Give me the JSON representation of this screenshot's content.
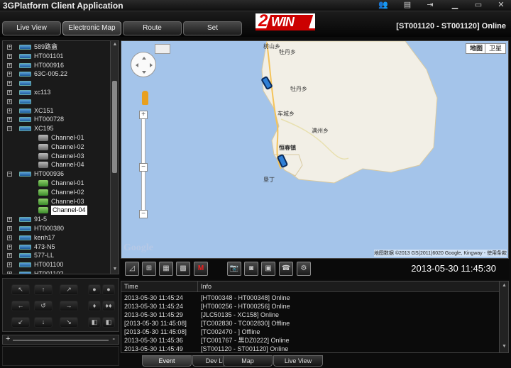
{
  "window": {
    "title": "3GPlatform Client Application"
  },
  "nav": {
    "buttons": [
      {
        "label": "Live View"
      },
      {
        "label": "Electronic Map"
      },
      {
        "label": "Route"
      },
      {
        "label": "Set"
      }
    ],
    "active_index": 1
  },
  "brand": {
    "logo_text_1": "2",
    "logo_text_2": "WIN"
  },
  "device_status": "[ST001120 - ST001120] Online",
  "tree": {
    "items": [
      {
        "type": "device",
        "label": "589路盦",
        "expanded": false
      },
      {
        "type": "device",
        "label": "HT001101",
        "expanded": false
      },
      {
        "type": "device",
        "label": "HT000916",
        "expanded": false
      },
      {
        "type": "device",
        "label": "63C-005.22",
        "expanded": false
      },
      {
        "type": "device",
        "label": "",
        "expanded": false
      },
      {
        "type": "device",
        "label": "xc113",
        "expanded": false
      },
      {
        "type": "device",
        "label": "",
        "expanded": false
      },
      {
        "type": "device",
        "label": "XC151",
        "expanded": false
      },
      {
        "type": "device",
        "label": "HT000728",
        "expanded": false
      },
      {
        "type": "device",
        "label": "XC195",
        "expanded": true
      },
      {
        "type": "channel",
        "label": "Channel-01",
        "online": false
      },
      {
        "type": "channel",
        "label": "Channel-02",
        "online": false
      },
      {
        "type": "channel",
        "label": "Channel-03",
        "online": false
      },
      {
        "type": "channel",
        "label": "Channel-04",
        "online": false
      },
      {
        "type": "device",
        "label": "HT000936",
        "expanded": true
      },
      {
        "type": "channel",
        "label": "Channel-01",
        "online": true
      },
      {
        "type": "channel",
        "label": "Channel-02",
        "online": true
      },
      {
        "type": "channel",
        "label": "Channel-03",
        "online": true
      },
      {
        "type": "channel",
        "label": "Channel-04",
        "online": true,
        "selected": true
      },
      {
        "type": "device",
        "label": "91-5",
        "expanded": false
      },
      {
        "type": "device",
        "label": "HT000380",
        "expanded": false
      },
      {
        "type": "device",
        "label": "kenh17",
        "expanded": false
      },
      {
        "type": "device",
        "label": "473-N5",
        "expanded": false
      },
      {
        "type": "device",
        "label": "577-LL",
        "expanded": false
      },
      {
        "type": "device",
        "label": "HT001100",
        "expanded": false
      },
      {
        "type": "device",
        "label": "HT001102",
        "expanded": false
      }
    ]
  },
  "ptz": {
    "buttons": [
      "↖",
      "↑",
      "↗",
      "●",
      "●",
      "←",
      "↺",
      "→",
      "♦",
      "♦♦",
      "↙",
      "↓",
      "↘",
      "◧",
      "◧"
    ]
  },
  "zoom": {
    "minus": "+",
    "plus": "-"
  },
  "map": {
    "type_buttons": [
      "地图",
      "卫星"
    ],
    "labels": [
      {
        "text": "枋山乡"
      },
      {
        "text": "牡丹乡"
      },
      {
        "text": "牡丹乡"
      },
      {
        "text": "车城乡"
      },
      {
        "text": "满州乡"
      },
      {
        "text": "恒春镇"
      },
      {
        "text": "垦丁"
      }
    ],
    "zoom_in": "+",
    "zoom_out": "−",
    "zoom_min": "−",
    "google_logo": "Google",
    "copyright": "地图数据 ©2013 GS(2011)6020 Google, Kingway - 使用条款"
  },
  "toolbar": {
    "buttons": [
      "layout-1",
      "layout-4",
      "layout-9",
      "layout-16",
      "layout-M",
      "snapshot",
      "capture",
      "record",
      "talk",
      "settings"
    ],
    "m_label": "M",
    "datetime": "2013-05-30  11:45:30"
  },
  "log": {
    "columns": [
      "Time",
      "Info"
    ],
    "rows": [
      {
        "time": "2013-05-30 11:45:24",
        "info": "[HT000348 - HT000348] Online"
      },
      {
        "time": "2013-05-30 11:45:24",
        "info": "[HT000256 - HT000256] Online"
      },
      {
        "time": "2013-05-30 11:45:29",
        "info": "[JLC50135 - XC158] Online"
      },
      {
        "time": "[2013-05-30 11:45:08]",
        "info": "[TC002830 - TC002830] Offline"
      },
      {
        "time": "[2013-05-30 11:45:08]",
        "info": "[TC002470 - ] Offline"
      },
      {
        "time": "2013-05-30 11:45:36",
        "info": "[TC001767 - 黒DZ0222] Online"
      },
      {
        "time": "2013-05-30 11:45:49",
        "info": "[ST001120 - ST001120] Online"
      }
    ]
  },
  "bottom_tabs": [
    "Event",
    "Dev List",
    "Map",
    "Live View"
  ],
  "bottom_tab_active": 0
}
